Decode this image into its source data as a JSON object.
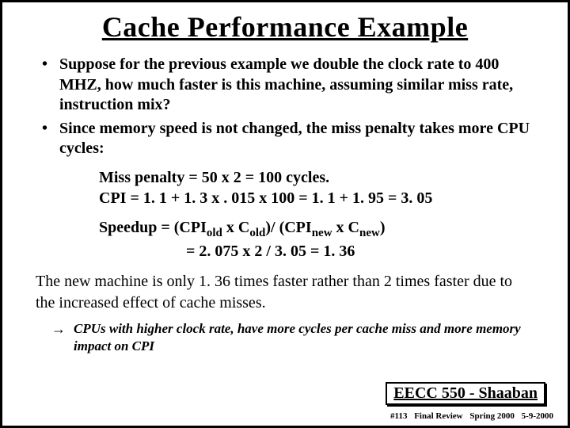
{
  "title": "Cache Performance Example",
  "bullets": [
    "Suppose for the previous example we double the clock rate to 400 MHZ, how much faster is this machine, assuming similar miss rate, instruction mix?",
    "Since memory speed is not changed, the miss penalty takes more CPU cycles:"
  ],
  "equations": {
    "line1": "Miss penalty =  50  x  2  =  100 cycles.",
    "line2": "CPI =  1. 1 +  1. 3 x . 015 x 100 =  1. 1 + 1. 95 =  3. 05"
  },
  "speedup": {
    "label": "Speedup  =   (CPI",
    "sub_old": "old",
    "mid1": " x C",
    "mid2": ")/ (CPI",
    "sub_new": "new",
    "mid3": " x C",
    "close": ")",
    "line2": "=  2. 075  x 2 /  3. 05  =  1. 36"
  },
  "conclusion": "The new machine is only 1. 36 times faster rather than 2 times faster due to the increased effect of cache misses.",
  "note": "CPUs with higher clock rate, have more cycles per cache miss and more memory impact on CPI",
  "footer": {
    "course": "EECC 550 - Shaaban",
    "slide_no": "#113",
    "section": "Final Review",
    "term": "Spring 2000",
    "date": "5-9-2000"
  }
}
